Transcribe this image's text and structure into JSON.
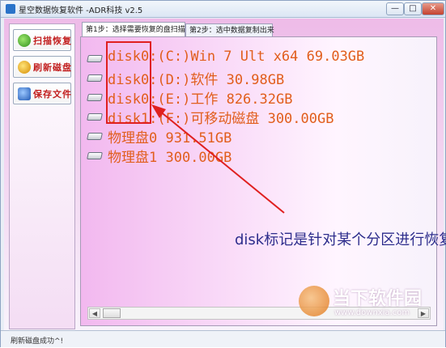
{
  "window": {
    "title": "星空数据恢复软件   -ADR科技 v2.5",
    "minimize": "—",
    "maximize": "□",
    "close": "✕"
  },
  "sidebar": {
    "buttons": [
      {
        "label": "扫描恢复",
        "icon": "scan-icon"
      },
      {
        "label": "刷新磁盘",
        "icon": "refresh-icon"
      },
      {
        "label": "保存文件",
        "icon": "save-icon"
      }
    ]
  },
  "tabs": [
    {
      "label": "第1步：选择需要恢复的盘扫描"
    },
    {
      "label": "第2步：选中数据复制出来"
    }
  ],
  "drives": [
    {
      "label": "disk0:(C:)Win 7 Ult x64 69.03GB"
    },
    {
      "label": "disk0:(D:)软件 30.98GB"
    },
    {
      "label": "disk0:(E:)工作 826.32GB"
    },
    {
      "label": "disk1:(F:)可移动磁盘 300.00GB"
    },
    {
      "label": "物理盘0 931.51GB"
    },
    {
      "label": "物理盘1 300.00GB"
    }
  ],
  "annotation": {
    "text": "disk标记是针对某个分区进行恢复",
    "highlight_color": "#e02020",
    "arrow_color": "#e02020"
  },
  "statusbar": {
    "text": "刷新磁盘成功^!"
  },
  "watermark": {
    "text": "当下软件园",
    "url": "www.downxia.com"
  }
}
